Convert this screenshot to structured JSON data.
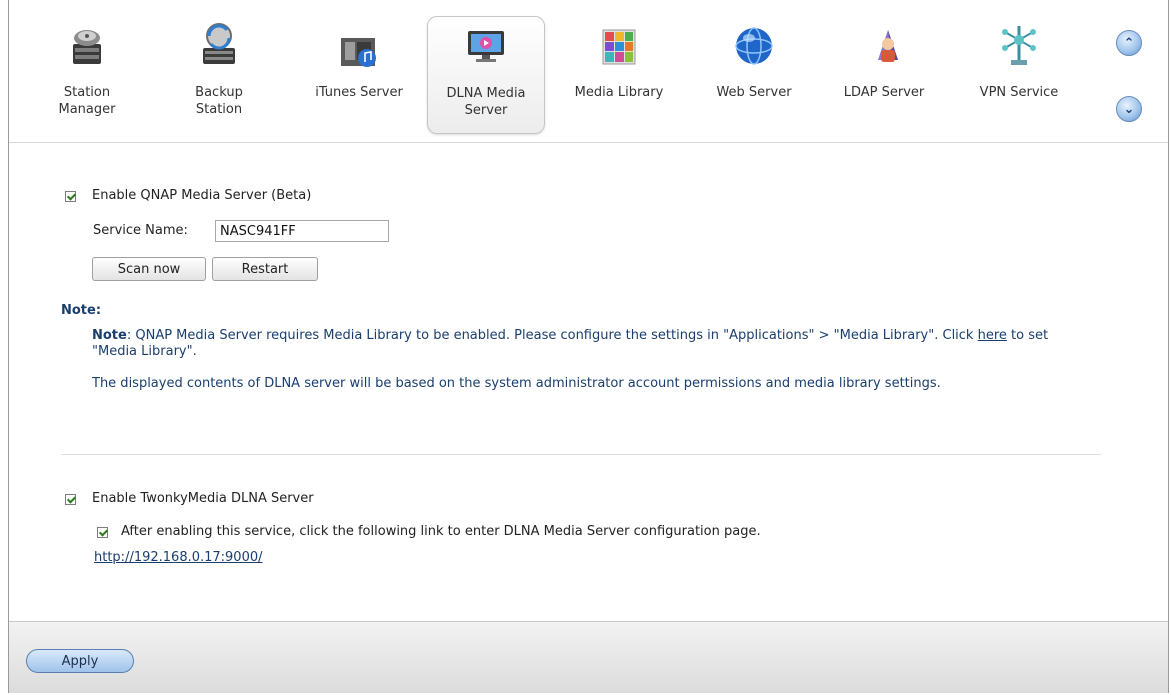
{
  "toolbar": {
    "items": [
      {
        "label": "Station\nManager",
        "icon": "station-manager-icon"
      },
      {
        "label": "Backup\nStation",
        "icon": "backup-station-icon"
      },
      {
        "label": "iTunes Server",
        "icon": "itunes-server-icon"
      },
      {
        "label": "DLNA Media\nServer",
        "icon": "dlna-media-server-icon",
        "active": true
      },
      {
        "label": "Media Library",
        "icon": "media-library-icon"
      },
      {
        "label": "Web Server",
        "icon": "web-server-icon"
      },
      {
        "label": "LDAP Server",
        "icon": "ldap-server-icon"
      },
      {
        "label": "VPN Service",
        "icon": "vpn-service-icon"
      }
    ],
    "scroll_up_icon": "chevron-up-icon",
    "scroll_down_icon": "chevron-down-icon"
  },
  "qnap": {
    "enable_label": "Enable QNAP Media Server (Beta)",
    "enable_checked": true,
    "service_name_label": "Service Name:",
    "service_name_value": "NASC941FF",
    "scan_button": "Scan now",
    "restart_button": "Restart"
  },
  "note": {
    "title": "Note:",
    "bold_prefix": "Note",
    "line1_a": ": QNAP Media Server requires Media Library to be enabled. Please configure the settings in \"Applications\" > \"Media Library\". Click ",
    "line1_link": "here",
    "line1_b": " to set \"Media Library\".",
    "line2": "The displayed contents of DLNA server will be based on the system administrator account permissions and media library settings."
  },
  "twonky": {
    "enable_label": "Enable TwonkyMedia DLNA Server",
    "enable_checked": true,
    "sub_label": "After enabling this service, click the following link to enter DLNA Media Server configuration page.",
    "sub_checked": true,
    "link": "http://192.168.0.17:9000/"
  },
  "footer": {
    "apply_button": "Apply"
  },
  "colors": {
    "note_text": "#1a3e6e",
    "accent_blue": "#9fc3ea"
  }
}
